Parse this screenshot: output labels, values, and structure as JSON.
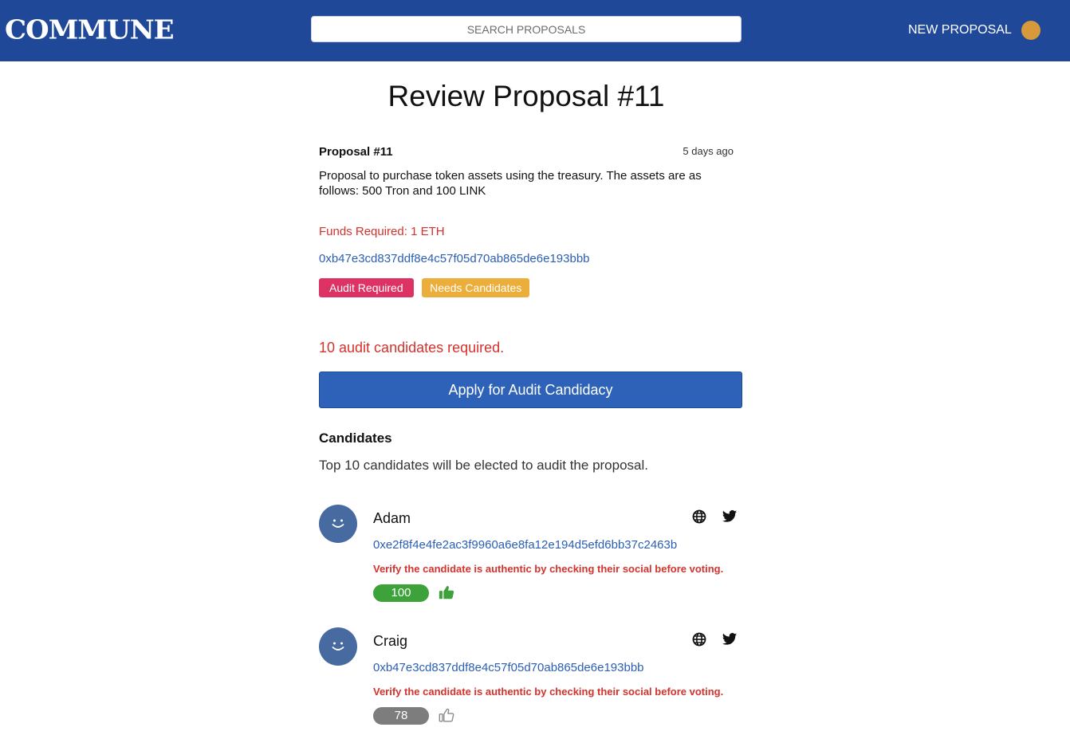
{
  "header": {
    "logo": "COMMUNE",
    "search_placeholder": "SEARCH PROPOSALS",
    "new_proposal_label": "NEW PROPOSAL",
    "avatar_color": "#d69a3c",
    "bar_color": "#1f4898"
  },
  "page": {
    "title": "Review Proposal #11"
  },
  "proposal": {
    "name": "Proposal #11",
    "time": "5 days ago",
    "description": "Proposal to purchase token assets using the treasury. The assets are as follows: 500 Tron and 100 LINK",
    "funds": "Funds Required: 1 ETH",
    "address": "0xb47e3cd837ddf8e4c57f05d70ab865de6e193bbb",
    "badges": [
      "Audit Required",
      "Needs Candidates"
    ]
  },
  "audit": {
    "required_text": "10 audit candidates required.",
    "apply_label": "Apply for Audit Candidacy"
  },
  "candidates": {
    "heading": "Candidates",
    "subtitle": "Top 10 candidates will be elected to audit the proposal.",
    "items": [
      {
        "name": "Adam",
        "address": "0xe2f8f4e4fe2ac3f9960a6e8fa12e194d5efd6bb37c2463b",
        "warning": "Verify the candidate is authentic by checking their social before voting.",
        "votes": "100",
        "voted": true
      },
      {
        "name": "Craig",
        "address": "0xb47e3cd837ddf8e4c57f05d70ab865de6e193bbb",
        "warning": "Verify the candidate is authentic by checking their social before voting.",
        "votes": "78",
        "voted": false
      }
    ]
  },
  "colors": {
    "primary": "#2d62b8",
    "danger": "#d4322c",
    "link": "#2b5fb3",
    "badge_audit": "#dc3364",
    "badge_needs": "#ecae3a",
    "vote_on": "#3ea23a",
    "vote_off": "#7d7d7d"
  },
  "icons": [
    "globe-icon",
    "twitter-icon",
    "thumbs-up-icon",
    "smiley-avatar-icon"
  ]
}
